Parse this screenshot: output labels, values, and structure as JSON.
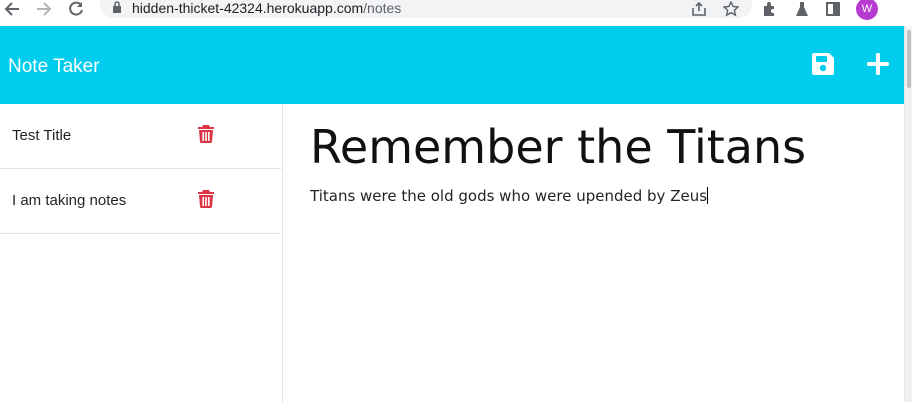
{
  "browser": {
    "url_host": "hidden-thicket-42324.herokuapp.com",
    "url_path": "/notes",
    "profile_initial": "W",
    "icons": [
      "back-icon",
      "forward-icon",
      "reload-icon",
      "lock-icon",
      "share-icon",
      "bookmark-star-icon",
      "extensions-icon",
      "labs-icon",
      "side-panel-icon"
    ]
  },
  "header": {
    "brand": "Note Taker",
    "background": "#00ccee",
    "actions": [
      "save-icon",
      "add-icon"
    ]
  },
  "notes": [
    {
      "title": "Test Title"
    },
    {
      "title": "I am taking notes"
    }
  ],
  "editor": {
    "title": "Remember the Titans",
    "body": "Titans were the old gods who were upended by Zeus"
  },
  "colors": {
    "delete_icon": "#dc3545",
    "divider": "#dee2e6"
  }
}
